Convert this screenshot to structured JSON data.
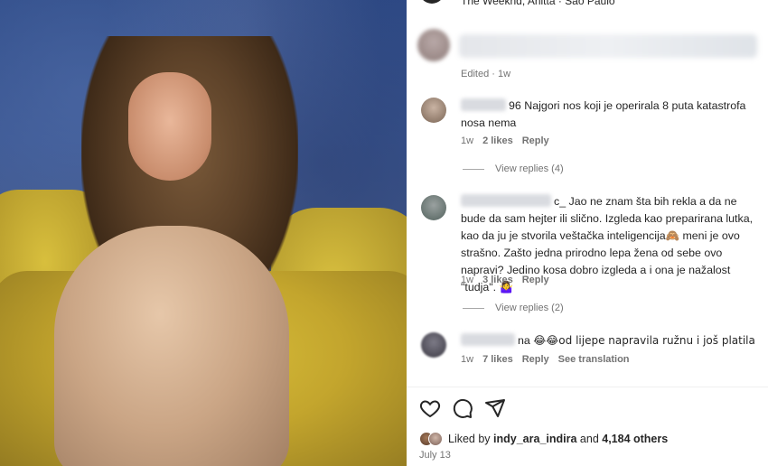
{
  "post": {
    "photo_alt": "woman-on-yellow-sofa",
    "header_caption": "The Weeknd, Anitta · São Paulo",
    "first_comment": {
      "edited": "Edited · 1w"
    }
  },
  "comments": [
    {
      "username_suffix": "96",
      "text": "Najgori nos koji je operirala 8 puta katastrofa nosa nema",
      "time": "1w",
      "likes": "2 likes",
      "reply": "Reply",
      "view_replies": "View replies (4)"
    },
    {
      "username_suffix": "c_",
      "text": "Jao ne znam šta bih rekla a da ne bude da sam hejter ili slično. Izgleda kao preparirana lutka, kao da ju je stvorila veštačka inteligencija🙈 meni je ovo strašno. Zašto jedna prirodno lepa žena od sebe ovo napravi? Jedino kosa dobro izgleda a i ona je nažalost \"tudja\". 🤷‍♀️",
      "time": "1w",
      "likes": "3 likes",
      "reply": "Reply",
      "view_replies": "View replies (2)"
    },
    {
      "username_suffix": "na",
      "text": "😂😂od lijepe napravila ružnu i još platila",
      "time": "1w",
      "likes": "7 likes",
      "reply": "Reply",
      "translation": "See translation"
    }
  ],
  "footer": {
    "liked_by_prefix": "Liked by ",
    "liked_by_user": "indy_ara_indira",
    "liked_and": " and ",
    "others": "4,184 others",
    "date": "July 13"
  }
}
